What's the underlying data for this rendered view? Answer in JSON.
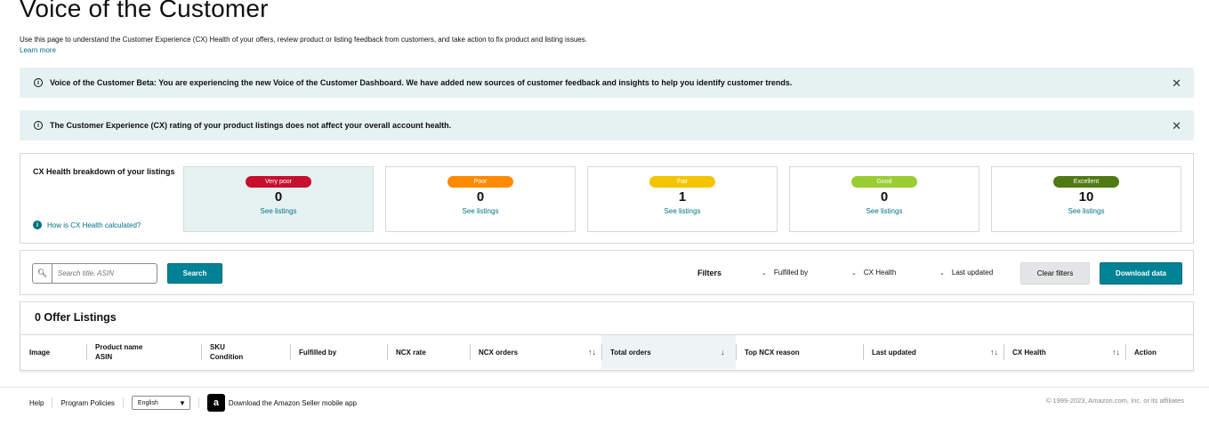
{
  "header": {
    "title": "Voice of the Customer",
    "description": "Use this page to understand the Customer Experience (CX) Health of your offers, review product or listing feedback from customers, and take action to fix product and listing issues.",
    "learn_more": "Learn more"
  },
  "alerts": [
    {
      "text": "Voice of the Customer Beta: You are experiencing the new Voice of the Customer Dashboard. We have added new sources of customer feedback and insights to help you identify customer trends."
    },
    {
      "text": "The Customer Experience (CX) rating of your product listings does not affect your overall account health."
    }
  ],
  "cx_health": {
    "heading": "CX Health breakdown of your listings",
    "help_link": "How is CX Health calculated?",
    "cards": [
      {
        "label": "Very poor",
        "count": "0",
        "link": "See listings",
        "pill_color": "#c7102e",
        "text_color": "#ffffff"
      },
      {
        "label": "Poor",
        "count": "0",
        "link": "See listings",
        "pill_color": "#ff8a00",
        "text_color": "#ffffff"
      },
      {
        "label": "Fair",
        "count": "1",
        "link": "See listings",
        "pill_color": "#f5c400",
        "text_color": "#ffffff"
      },
      {
        "label": "Good",
        "count": "0",
        "link": "See listings",
        "pill_color": "#9acd32",
        "text_color": "#ffffff"
      },
      {
        "label": "Excellent",
        "count": "10",
        "link": "See listings",
        "pill_color": "#4f7a13",
        "text_color": "#ffffff"
      }
    ]
  },
  "filters": {
    "search_placeholder": "Search title, ASIN",
    "search_button": "Search",
    "label": "Filters",
    "dropdowns": [
      "Fulfilled by",
      "CX Health",
      "Last updated"
    ],
    "clear_button": "Clear filters",
    "download_button": "Download data"
  },
  "table": {
    "title": "0 Offer Listings",
    "columns": [
      {
        "line1": "Image",
        "line2": ""
      },
      {
        "line1": "Product name",
        "line2": "ASIN"
      },
      {
        "line1": "SKU",
        "line2": "Condition"
      },
      {
        "line1": "Fulfilled by",
        "line2": ""
      },
      {
        "line1": "NCX rate",
        "line2": ""
      },
      {
        "line1": "NCX orders",
        "line2": ""
      },
      {
        "line1": "Total orders",
        "line2": ""
      },
      {
        "line1": "Top NCX reason",
        "line2": ""
      },
      {
        "line1": "Last updated",
        "line2": ""
      },
      {
        "line1": "CX Health",
        "line2": ""
      },
      {
        "line1": "Action",
        "line2": ""
      }
    ]
  },
  "footer": {
    "help": "Help",
    "policies": "Program Policies",
    "language": "English",
    "app_text": "Download the Amazon Seller mobile app",
    "copyright": "© 1999-2023, Amazon.com, Inc. or its affiliates"
  },
  "colors": {
    "accent": "#008296",
    "link": "#007185",
    "alert_bg": "#e6f2f2"
  }
}
